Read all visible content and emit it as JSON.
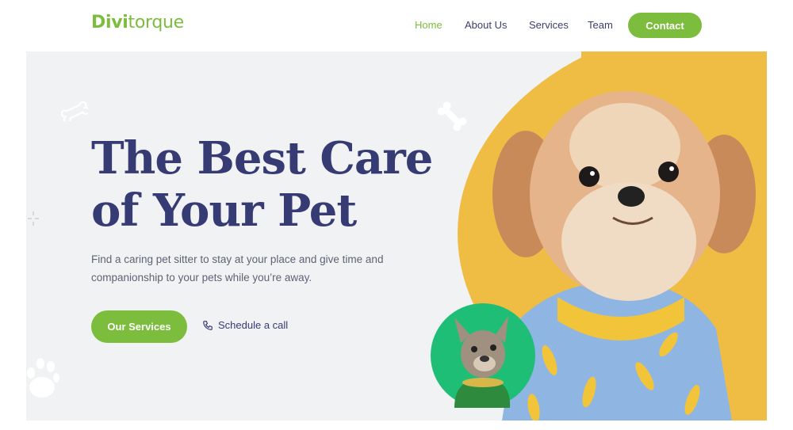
{
  "header": {
    "logo_part1": "Divi",
    "logo_part2": "torque",
    "nav": [
      {
        "label": "Home",
        "active": true
      },
      {
        "label": "About Us",
        "active": false
      },
      {
        "label": "Services",
        "active": false
      },
      {
        "label": "Team",
        "active": false
      }
    ],
    "contact_label": "Contact"
  },
  "hero": {
    "title_line1": "The Best Care",
    "title_line2": "of Your Pet",
    "description": "Find a caring pet sitter to stay at your place and give time and companionship to your pets while you’re away.",
    "primary_button": "Our Services",
    "secondary_link": "Schedule a call",
    "main_image": "dog-in-banana-shirt-photo",
    "secondary_image": "french-bulldog-photo"
  },
  "colors": {
    "brand_green": "#7cbd3d",
    "navy": "#363b73",
    "hero_bg": "#f1f2f4",
    "yellow": "#efbd44",
    "teal_green": "#1fbe76"
  },
  "icons": [
    "bone-icon",
    "paw-icon",
    "phone-icon",
    "sparkle-icon"
  ]
}
